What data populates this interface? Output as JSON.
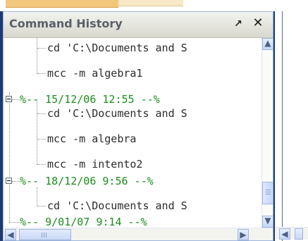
{
  "panel": {
    "title": "Command History",
    "undock_glyph": "↗",
    "close_glyph": "✕"
  },
  "history": [
    {
      "type": "command",
      "text": "cd 'C:\\Documents and S"
    },
    {
      "type": "command",
      "text": "mcc -m algebra1"
    },
    {
      "type": "session",
      "text": "%-- 15/12/06 12:55 --%"
    },
    {
      "type": "command",
      "text": "cd 'C:\\Documents and S"
    },
    {
      "type": "command",
      "text": "mcc -m algebra"
    },
    {
      "type": "command",
      "text": "mcc -m intento2"
    },
    {
      "type": "session",
      "text": "%-- 18/12/06 9:56 --%"
    },
    {
      "type": "command",
      "text": "cd 'C:\\Documents and S"
    },
    {
      "type": "session",
      "text": "%-- 9/01/07 9:14 --%"
    }
  ],
  "scrollbar": {
    "up": "▲",
    "down": "▼",
    "left": "◀",
    "right": "▶"
  }
}
